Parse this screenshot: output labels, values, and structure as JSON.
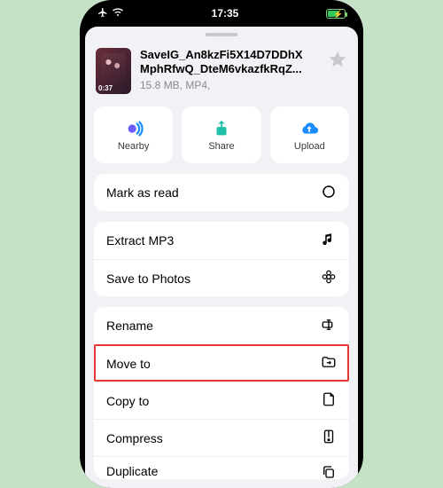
{
  "status": {
    "time": "17:35"
  },
  "file": {
    "name_line1": "SaveIG_An8kzFi5X14D7DDhX",
    "name_line2": "MphRfwQ_DteM6vkazfkRqZ...",
    "info": "15.8 MB, MP4,",
    "duration": "0:37"
  },
  "quick_actions": {
    "nearby": "Nearby",
    "share": "Share",
    "upload": "Upload"
  },
  "rows": {
    "mark_read": "Mark as read",
    "extract_mp3": "Extract MP3",
    "save_photos": "Save to Photos",
    "rename": "Rename",
    "move_to": "Move to",
    "copy_to": "Copy to",
    "compress": "Compress",
    "duplicate": "Duplicate"
  },
  "colors": {
    "accent_blue": "#1a8cff",
    "accent_teal": "#1fbfa8"
  }
}
